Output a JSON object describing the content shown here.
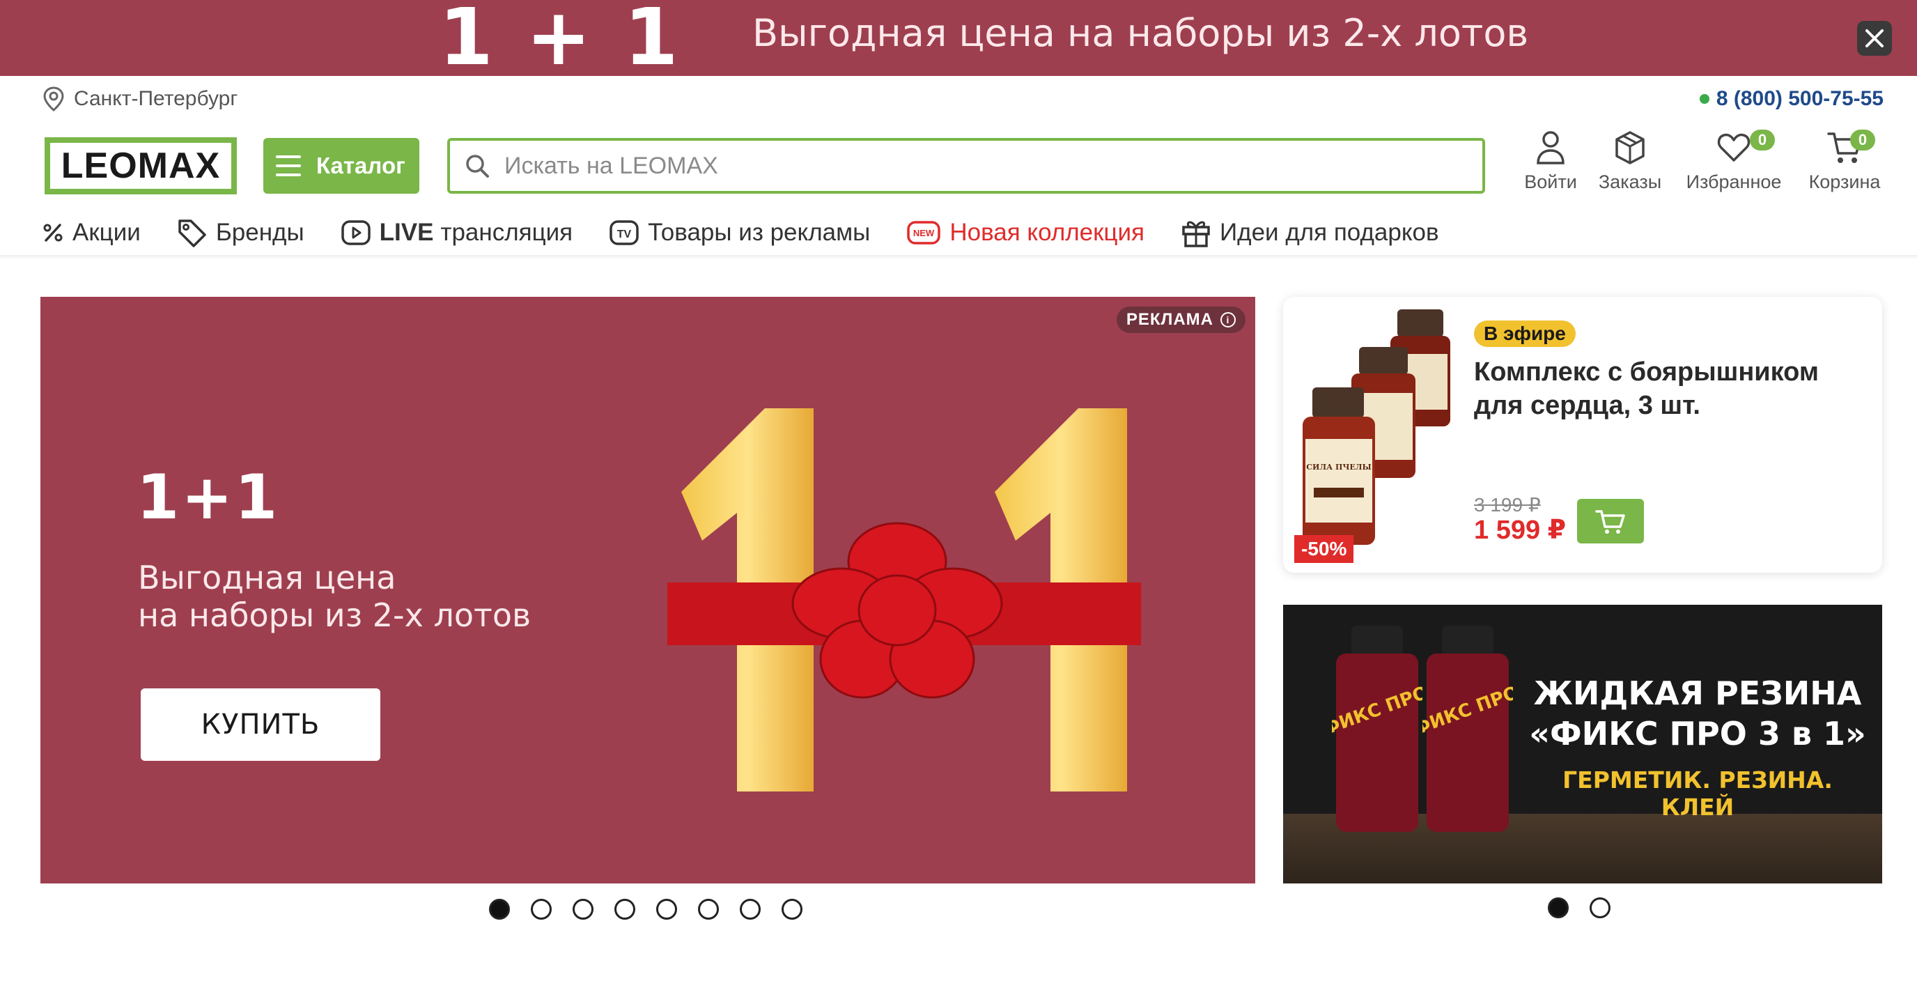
{
  "promo_bar": {
    "big_text": "1 + 1",
    "text": "Выгодная цена на наборы из 2-х лотов"
  },
  "location": {
    "city": "Санкт-Петербург"
  },
  "phone": {
    "number": "8 (800) 500-75-55",
    "status_color": "#3aaa4a"
  },
  "header": {
    "logo": "LEOMAX",
    "catalog_label": "Каталог",
    "search_placeholder": "Искать на LEOMAX",
    "actions": {
      "login": {
        "label": "Войти",
        "icon": "user-icon"
      },
      "orders": {
        "label": "Заказы",
        "icon": "box-icon"
      },
      "favorites": {
        "label": "Избранное",
        "icon": "heart-icon",
        "count": "0"
      },
      "cart": {
        "label": "Корзина",
        "icon": "cart-icon",
        "count": "0"
      }
    }
  },
  "nav": {
    "items": [
      {
        "label": "Акции",
        "icon": "percent-icon"
      },
      {
        "label": "Бренды",
        "icon": "tag-icon"
      },
      {
        "label_bold": "LIVE",
        "label": "трансляция",
        "icon": "play-icon"
      },
      {
        "label": "Товары из рекламы",
        "icon": "tv-icon"
      },
      {
        "label": "Новая коллекция",
        "icon": "new-icon"
      },
      {
        "label": "Идеи для подарков",
        "icon": "gift-icon"
      }
    ]
  },
  "main_banner": {
    "ad_label": "РЕКЛАМА",
    "big_text": "1+1",
    "line1": "Выгодная цена",
    "line2": "на наборы из 2-х лотов",
    "button_label": "КУПИТЬ",
    "slides_total": 8,
    "active_slide": 1
  },
  "product_card": {
    "badge": "В эфире",
    "title": "Комплекс с боярышником для сердца, 3 шт.",
    "old_price": "3 199 ₽",
    "new_price": "1 599 ₽",
    "discount": "-50%",
    "label_text": "СИЛА ПЧЕЛЫ"
  },
  "side_banner": {
    "line1": "ЖИДКАЯ РЕЗИНА",
    "line2": "«ФИКС ПРО 3 в 1»",
    "line3": "ГЕРМЕТИК. РЕЗИНА. КЛЕЙ",
    "can_text": "ФИКС ПРО",
    "slides_total": 2,
    "active_slide": 1
  },
  "colors": {
    "brand_green": "#7ab648",
    "promo_red": "#9e3f4f",
    "accent_red": "#e02b2b",
    "badge_yellow": "#f2c12e",
    "phone_blue": "#1f4a8a"
  }
}
